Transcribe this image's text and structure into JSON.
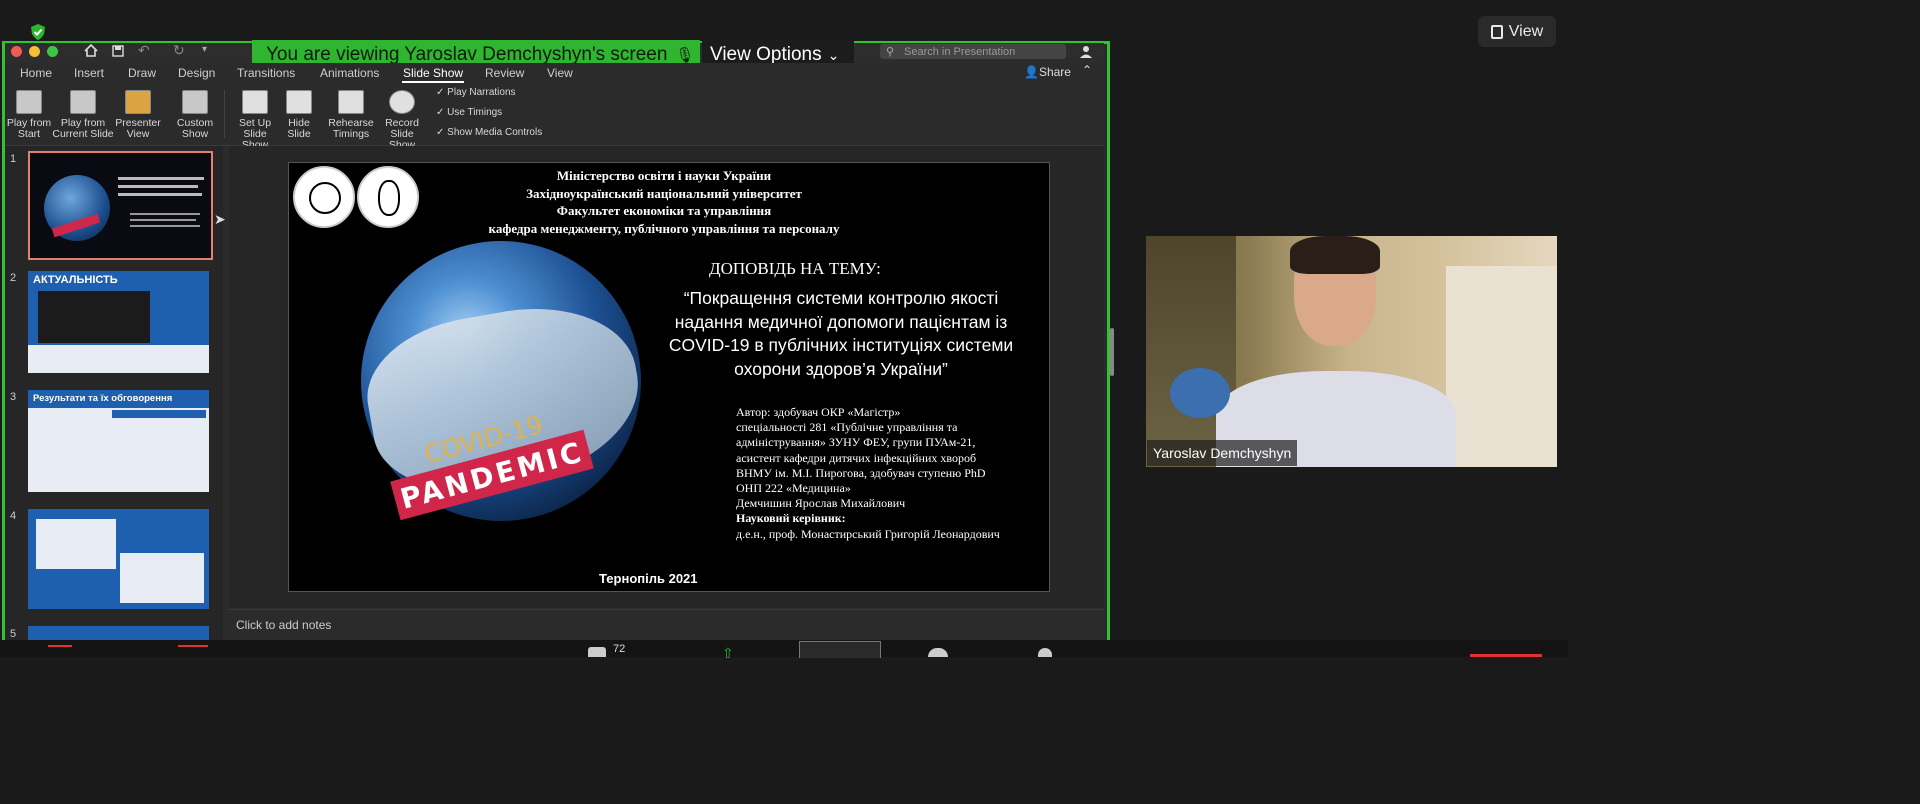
{
  "zoom": {
    "view_button": "View",
    "banner_text": "You are viewing Yaroslav Demchyshyn's screen",
    "view_options": "View Options",
    "participant_count": "72",
    "video_name": "Yaroslav Demchyshyn"
  },
  "ppt": {
    "search_placeholder": "Search in Presentation",
    "share_label": "Share",
    "tabs": [
      "Home",
      "Insert",
      "Draw",
      "Design",
      "Transitions",
      "Animations",
      "Slide Show",
      "Review",
      "View"
    ],
    "active_tab": "Slide Show",
    "ribbon_buttons": [
      {
        "line1": "Play from",
        "line2": "Start"
      },
      {
        "line1": "Play from",
        "line2": "Current Slide"
      },
      {
        "line1": "Presenter",
        "line2": "View"
      },
      {
        "line1": "Custom",
        "line2": "Show"
      },
      {
        "line1": "Set Up",
        "line2": "Slide Show"
      },
      {
        "line1": "Hide",
        "line2": "Slide"
      },
      {
        "line1": "Rehearse",
        "line2": "Timings"
      },
      {
        "line1": "Record",
        "line2": "Slide Show"
      }
    ],
    "checkboxes": [
      "Play Narrations",
      "Use Timings",
      "Show Media Controls"
    ],
    "notes_placeholder": "Click to add notes",
    "thumbnails": [
      {
        "num": "1",
        "title": ""
      },
      {
        "num": "2",
        "title": "АКТУАЛЬНІСТЬ"
      },
      {
        "num": "3",
        "title": "Результати та їх обговорення"
      },
      {
        "num": "4",
        "title": ""
      },
      {
        "num": "5",
        "title": ""
      }
    ],
    "slide": {
      "header": [
        "Міністерство освіти і науки України",
        "Західноукраїнський національний університет",
        "Факультет економіки та управління",
        "кафедра менеджменту, публічного управління та персоналу"
      ],
      "topic_label": "ДОПОВІДЬ НА ТЕМУ:",
      "topic_lines": [
        "“Покращення системи контролю якості",
        "надання медичної допомоги пацієнтам із",
        "COVID-19 в публічних інституціях системи",
        "охорони здоров’я України”"
      ],
      "author_lines": [
        "Автор: здобувач ОКР «Магістр»",
        "спеціальності 281 «Публічне управління та",
        "адміністрування» ЗУНУ ФЕУ, групи ПУАм-21,",
        "асистент кафедри дитячих інфекційних хвороб",
        "ВНМУ ім. М.І. Пирогова, здобувач ступеню PhD",
        "ОНП 222 «Медицина»",
        "Демчишин Ярослав Михайлович",
        "Науковий керівник:",
        "д.е.н., проф. Монастирський Григорій Леонардович"
      ],
      "covid_label": "COVID-19",
      "pandemic_label": "PANDEMIC",
      "footer": "Тернопіль 2021"
    }
  },
  "colors": {
    "share_border": "#34c233",
    "banner_bg": "#2fb52f",
    "thumb_blue": "#1f5fb0",
    "pandemic_red": "#d0264a"
  }
}
